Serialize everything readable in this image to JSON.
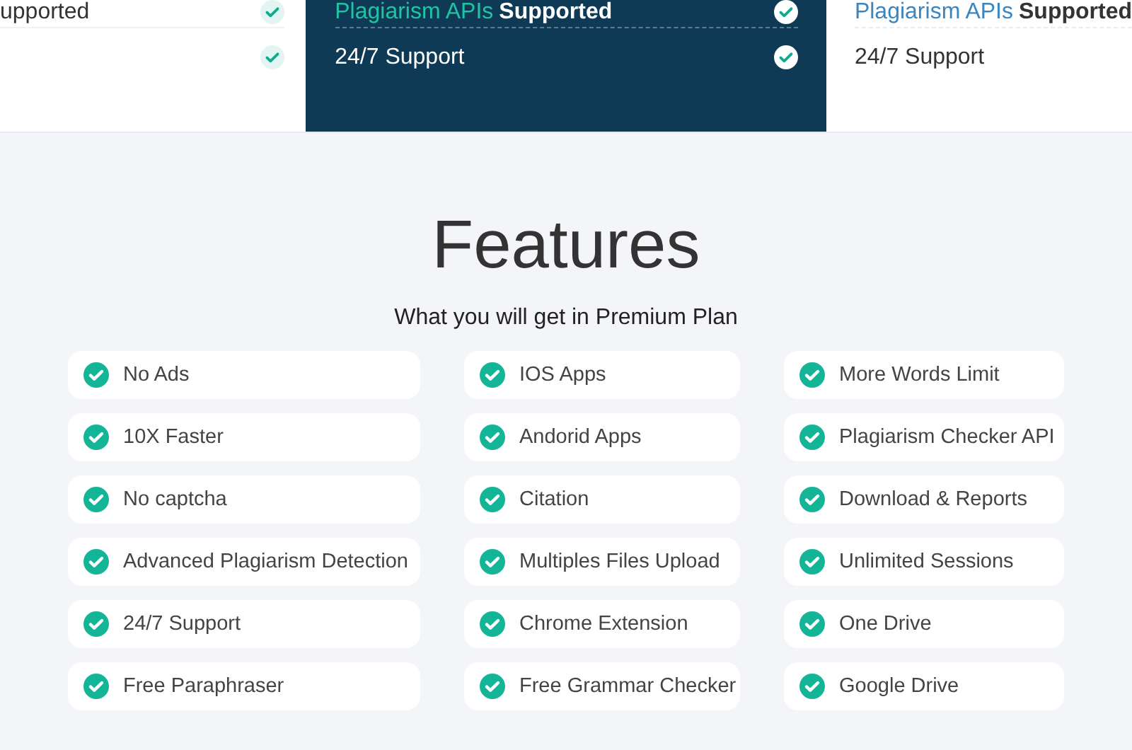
{
  "pricing_cards": [
    {
      "kind": "left",
      "rows": [
        {
          "text": "upported",
          "checked": true
        },
        {
          "checked": true
        }
      ]
    },
    {
      "kind": "featured",
      "rows": [
        {
          "highlight": "Plagiarism APIs",
          "text": "Supported",
          "checked": true
        },
        {
          "text": "24/7 Support",
          "checked": true
        }
      ]
    },
    {
      "kind": "right",
      "rows": [
        {
          "highlight": "Plagiarism APIs",
          "text": "Supported"
        },
        {
          "text": "24/7 Support"
        }
      ]
    }
  ],
  "features": {
    "title": "Features",
    "subtitle": "What you will get in Premium Plan",
    "columns": [
      [
        "No Ads",
        "10X Faster",
        "No captcha",
        "Advanced Plagiarism Detection",
        "24/7 Support",
        "Free Paraphraser"
      ],
      [
        "IOS Apps",
        "Andorid Apps",
        "Citation",
        "Multiples Files Upload",
        "Chrome Extension",
        "Free Grammar Checker"
      ],
      [
        "More Words Limit",
        "Plagiarism Checker API",
        "Download & Reports",
        "Unlimited Sessions",
        "One Drive",
        "Google Drive"
      ]
    ]
  }
}
